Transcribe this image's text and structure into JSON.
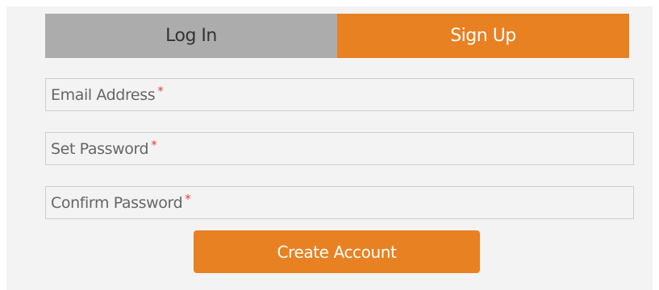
{
  "tabs": {
    "login_label": "Log In",
    "signup_label": "Sign Up",
    "active": "signup"
  },
  "form": {
    "email_label": "Email Address",
    "password_label": "Set Password",
    "confirm_label": "Confirm Password",
    "required_marker": "*",
    "email_value": "",
    "password_value": "",
    "confirm_value": ""
  },
  "submit": {
    "label": "Create Account"
  },
  "colors": {
    "accent": "#e88122",
    "inactive_tab": "#acacac",
    "background": "#f3f3f3",
    "required": "#e0452f"
  }
}
